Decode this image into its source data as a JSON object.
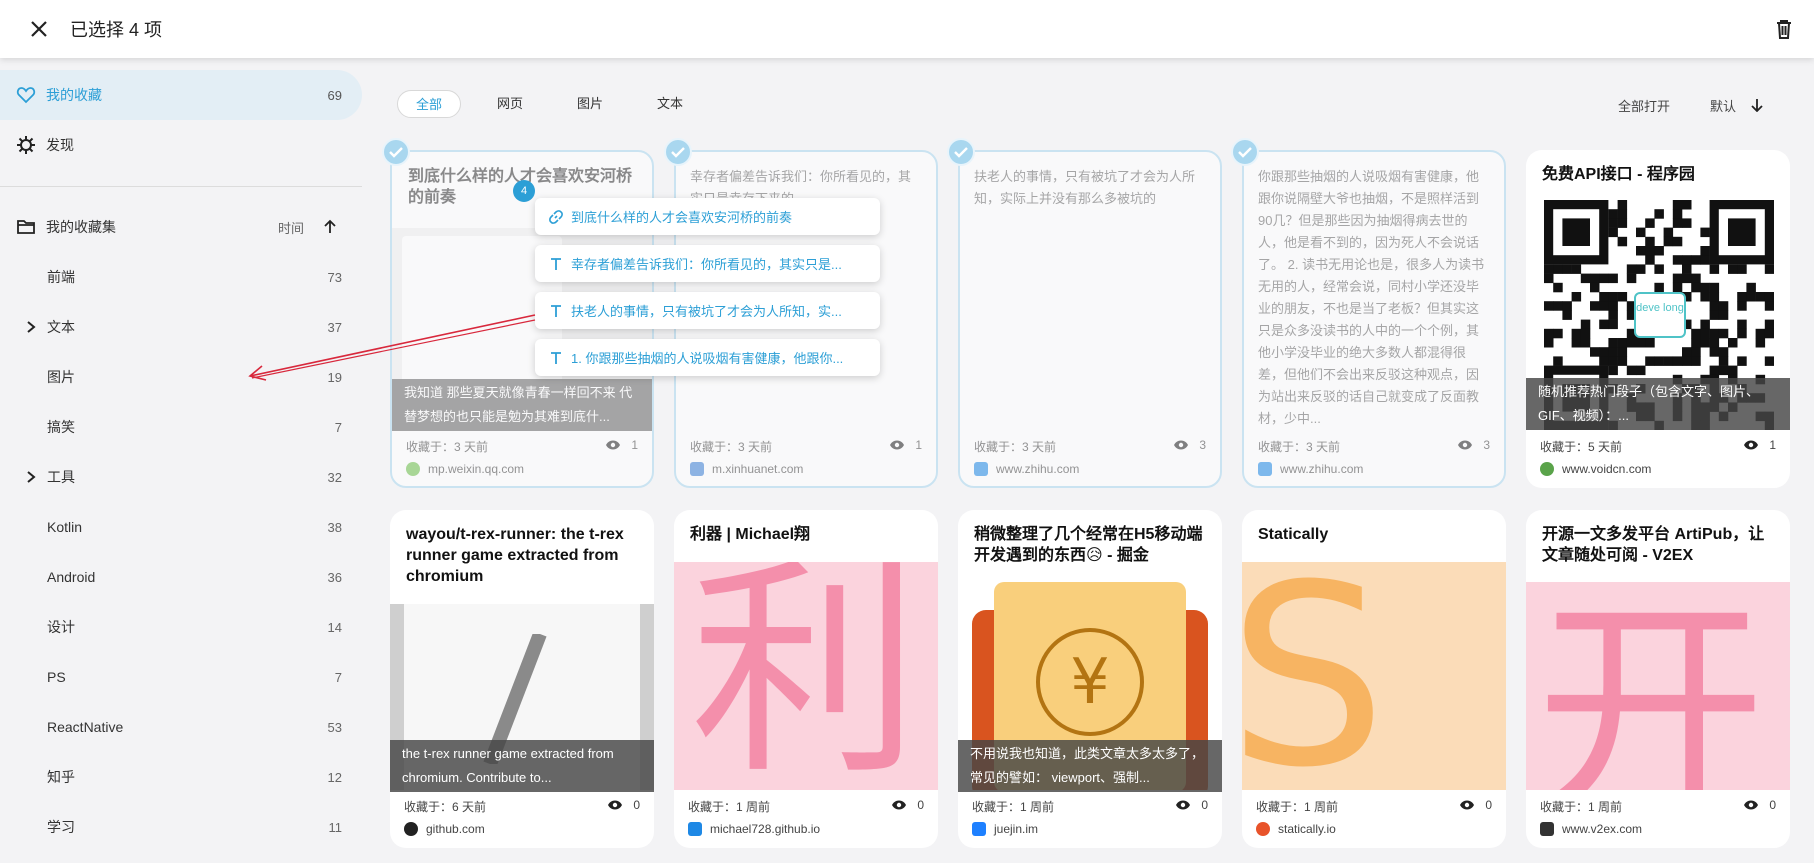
{
  "topbar": {
    "title": "已选择 4 项"
  },
  "sidebar": {
    "favorites": {
      "label": "我的收藏",
      "count": "69"
    },
    "discover": {
      "label": "发现"
    },
    "collections": {
      "label": "我的收藏集",
      "sort_label": "时间"
    },
    "items": [
      {
        "label": "前端",
        "count": "73",
        "expandable": false
      },
      {
        "label": "文本",
        "count": "37",
        "expandable": true
      },
      {
        "label": "图片",
        "count": "19",
        "expandable": false
      },
      {
        "label": "搞笑",
        "count": "7",
        "expandable": false
      },
      {
        "label": "工具",
        "count": "32",
        "expandable": true
      },
      {
        "label": "Kotlin",
        "count": "38",
        "expandable": false
      },
      {
        "label": "Android",
        "count": "36",
        "expandable": false
      },
      {
        "label": "设计",
        "count": "14",
        "expandable": false
      },
      {
        "label": "PS",
        "count": "7",
        "expandable": false
      },
      {
        "label": "ReactNative",
        "count": "53",
        "expandable": false
      },
      {
        "label": "知乎",
        "count": "12",
        "expandable": false
      },
      {
        "label": "学习",
        "count": "11",
        "expandable": false
      }
    ]
  },
  "filters": {
    "all": "全部",
    "web": "网页",
    "image": "图片",
    "text": "文本"
  },
  "tools": {
    "open_all": "全部打开",
    "sort": "默认"
  },
  "drag": {
    "count": "4",
    "items": [
      {
        "kind": "link",
        "text": "到底什么样的人才会喜欢安河桥的前奏"
      },
      {
        "kind": "text",
        "text": "幸存者偏差告诉我们：你所看见的，其实只是..."
      },
      {
        "kind": "text",
        "text": "扶老人的事情，只有被坑了才会为人所知，实..."
      },
      {
        "kind": "text",
        "text": "1. 你跟那些抽烟的人说吸烟有害健康，他跟你..."
      }
    ]
  },
  "cards_row1": [
    {
      "title": "到底什么样的人才会喜欢安河桥的前奏",
      "caption": "我知道 那些夏天就像青春一样回不来 代替梦想的也只能是勉为其难到底什...",
      "meta": "收藏于：3 天前",
      "views": "1",
      "site": "mp.weixin.qq.com",
      "fav_color": "#6cc04a"
    },
    {
      "text": "幸存者偏差告诉我们：你所看见的，其实只是幸存下来的...",
      "meta": "收藏于：3 天前",
      "views": "1",
      "site": "m.xinhuanet.com",
      "fav_color": "#3b7fd6"
    },
    {
      "text": "扶老人的事情，只有被坑了才会为人所知，实际上并没有那么多被坑的",
      "meta": "收藏于：3 天前",
      "views": "3",
      "site": "www.zhihu.com",
      "fav_color": "#1e88e5"
    },
    {
      "text": "你跟那些抽烟的人说吸烟有害健康，他跟你说隔壁大爷也抽烟，不是照样活到90几？但是那些因为抽烟得病去世的人，他是看不到的，因为死人不会说话了。 2. 读书无用论也是，很多人为读书无用的人，经常会说，同村小学还没毕业的朋友，不也是当了老板？但其实这只是众多没读书的人中的一个个例，其他小学没毕业的绝大多数人都混得很差，但他们不会出来反驳这种观点，因为站出来反驳的话自己就变成了反面教材，少中...",
      "meta": "收藏于：3 天前",
      "views": "3",
      "site": "www.zhihu.com",
      "fav_color": "#1e88e5"
    },
    {
      "title": "免费API接口 - 程序园",
      "caption": "随机推荐热门段子（包含文字、图片、GIF、视频）：...",
      "meta": "收藏于：5 天前",
      "views": "1",
      "site": "www.voidcn.com",
      "fav_color": "#5aa34a",
      "qr_label": "deve long"
    }
  ],
  "cards_row2": [
    {
      "title": "wayou/t-rex-runner: the t-rex runner game extracted from chromium",
      "caption": "the t-rex runner game extracted from chromium. Contribute to...",
      "meta": "收藏于：6 天前",
      "views": "0",
      "site": "github.com",
      "fav_color": "#222222"
    },
    {
      "title": "利器 | Michael翔",
      "image_char": "利",
      "meta": "收藏于：1 周前",
      "views": "0",
      "site": "michael728.github.io",
      "fav_color": "#1e88e5"
    },
    {
      "title": "稍微整理了几个经常在H5移动端开发遇到的东西😥 - 掘金",
      "image_char": "¥",
      "caption": "不用说我也知道，此类文章太多太多了，常见的譬如： viewport、强制...",
      "meta": "收藏于：1 周前",
      "views": "0",
      "site": "juejin.im",
      "fav_color": "#1e80ff"
    },
    {
      "title": "Statically",
      "image_char": "S",
      "meta": "收藏于：1 周前",
      "views": "0",
      "site": "statically.io",
      "fav_color": "#e8532a"
    },
    {
      "title": "开源一文多发平台 ArtiPub，让文章随处可阅 - V2EX",
      "image_char": "开",
      "meta": "收藏于：1 周前",
      "views": "0",
      "site": "www.v2ex.com",
      "fav_color": "#333333"
    }
  ],
  "colors": {
    "accent": "#2c9fd6",
    "selected_border": "#a9d7ef",
    "arrow": "#d8283c"
  }
}
